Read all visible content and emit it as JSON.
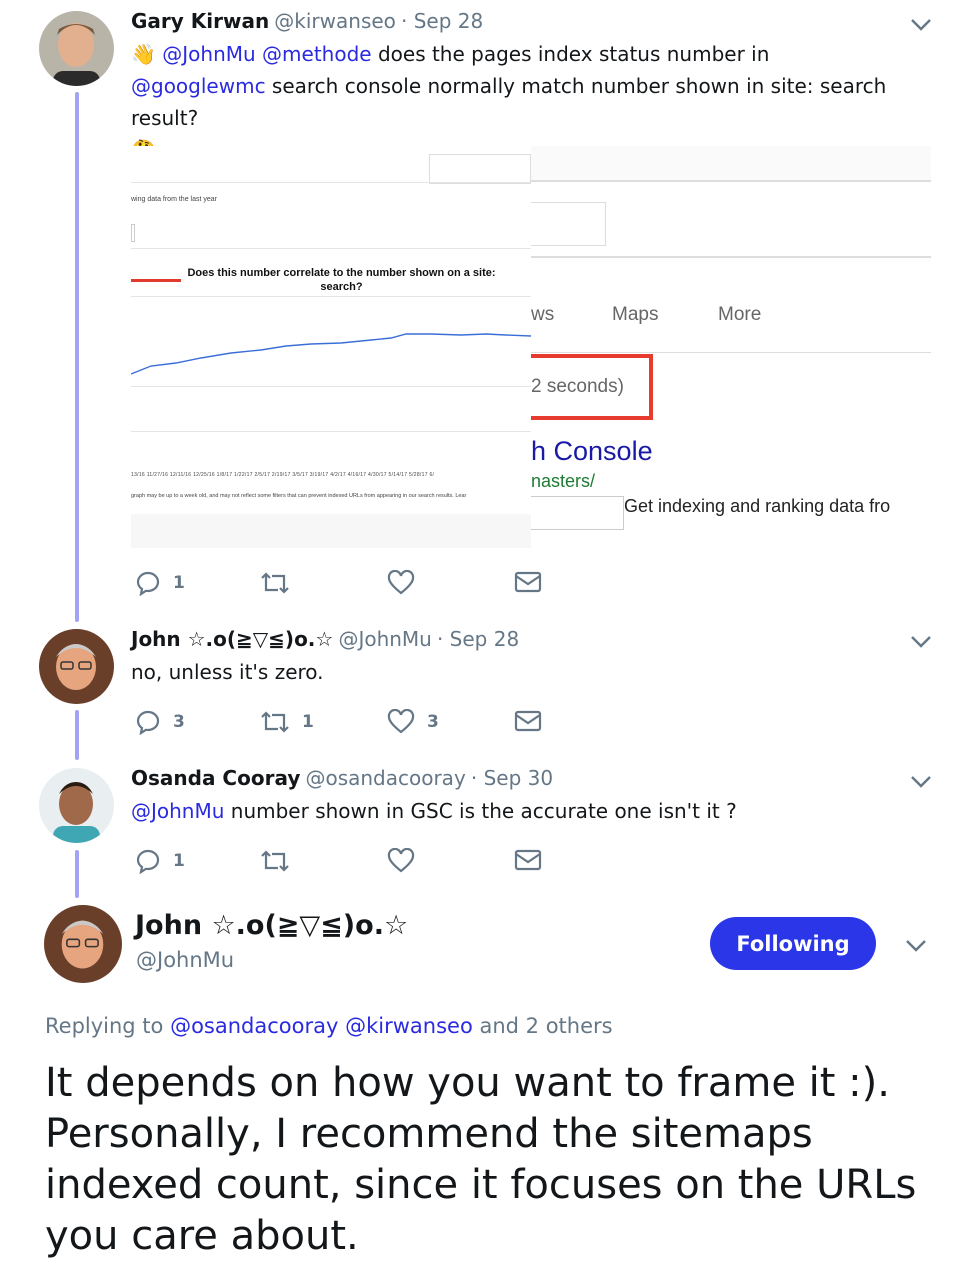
{
  "tweets": [
    {
      "name": "Gary Kirwan",
      "handle": "@kirwanseo",
      "date": "· Sep 28",
      "emoji_wave": "👋",
      "mention1": "@JohnMu",
      "mention2": "@methode",
      "text1": " does the pages index status number in",
      "mention3": "@googlewmc",
      "text2": " search console normally match number shown in site: search result?",
      "emoji_think": "🤔",
      "replies": "1",
      "retweets": "",
      "likes": ""
    },
    {
      "name": "John ☆.o(≧▽≦)o.☆",
      "handle": "@JohnMu",
      "date": "· Sep 28",
      "text": "no, unless it's zero.",
      "replies": "3",
      "retweets": "1",
      "likes": "3"
    },
    {
      "name": "Osanda Cooray",
      "handle": "@osandacooray",
      "date": "· Sep 30",
      "mention": "@JohnMu",
      "text": " number shown in GSC is the accurate one isn't it ?",
      "replies": "1",
      "retweets": "",
      "likes": ""
    }
  ],
  "embedded": {
    "left_caption": "wing data from the last year",
    "annotation": "Does this number correlate to the number shown on a site: search?",
    "dates": "13/16  11/27/16  12/11/16  12/25/16  1/8/17  1/22/17  2/5/17  2/19/17  3/5/17  3/19/17  4/2/17  4/16/17  4/30/17  5/14/17  5/28/17  6/",
    "footnote": "graph may be up to a week old, and may not reflect some filters that can prevent indexed URLs from appearing in our search results. Lear",
    "tab_news": "ws",
    "tab_maps": "Maps",
    "tab_more": "More",
    "seconds": "2 seconds)",
    "result_title": "h Console",
    "result_url": "nasters/",
    "result_snippet": "Get indexing and ranking data fro"
  },
  "main": {
    "name": "John ☆.o(≧▽≦)o.☆",
    "handle": "@JohnMu",
    "follow_label": "Following",
    "replying_prefix": "Replying to ",
    "replying_m1": "@osandacooray",
    "replying_m2": " @kirwanseo",
    "replying_suffix": " and 2 others",
    "text": "It depends on how you want to frame it :). Personally, I recommend the sitemaps indexed count, since it focuses on the URLs you care about."
  },
  "colors": {
    "accent": "#2a36e8",
    "mention": "#2a2ae0",
    "thread": "#a3a3f5",
    "muted": "#657786"
  }
}
